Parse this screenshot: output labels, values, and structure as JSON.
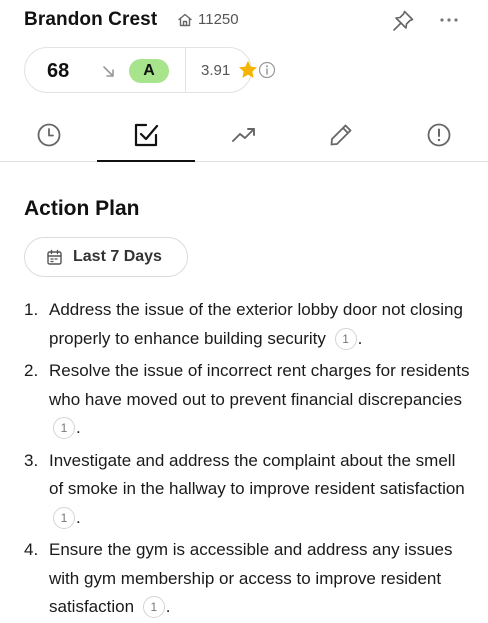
{
  "header": {
    "title": "Brandon Crest",
    "unit_icon": "home-icon",
    "unit_number": "11250",
    "pin_icon": "pin-icon",
    "more_icon": "more-horizontal-icon"
  },
  "score_card": {
    "score": "68",
    "trend_icon": "trend-down-arrow-icon",
    "grade": "A",
    "grade_color": "#a8e48c",
    "rating": "3.91",
    "rating_icon": "star-icon",
    "star_color": "#f5b400",
    "info_icon": "info-icon"
  },
  "tabs": [
    {
      "icon": "clock-icon",
      "active": false
    },
    {
      "icon": "checkbox-icon",
      "active": true
    },
    {
      "icon": "trending-up-icon",
      "active": false
    },
    {
      "icon": "pencil-icon",
      "active": false
    },
    {
      "icon": "alert-circle-icon",
      "active": false
    }
  ],
  "action_plan": {
    "title": "Action Plan",
    "range_icon": "calendar-icon",
    "range_label": "Last 7 Days",
    "items": [
      {
        "number": "1.",
        "text": "Address the issue of the exterior lobby door not closing properly to enhance building security",
        "citation": "1",
        "end": "."
      },
      {
        "number": "2.",
        "text": "Resolve the issue of incorrect rent charges for residents who have moved out to prevent financial discrepancies",
        "citation": "1",
        "end": "."
      },
      {
        "number": "3.",
        "text": "Investigate and address the complaint about the smell of smoke in the hallway to improve resident satisfaction",
        "citation": "1",
        "end": "."
      },
      {
        "number": "4.",
        "text": "Ensure the gym is accessible and address any issues with gym membership or access to improve resident satisfaction",
        "citation": "1",
        "end": "."
      }
    ]
  }
}
